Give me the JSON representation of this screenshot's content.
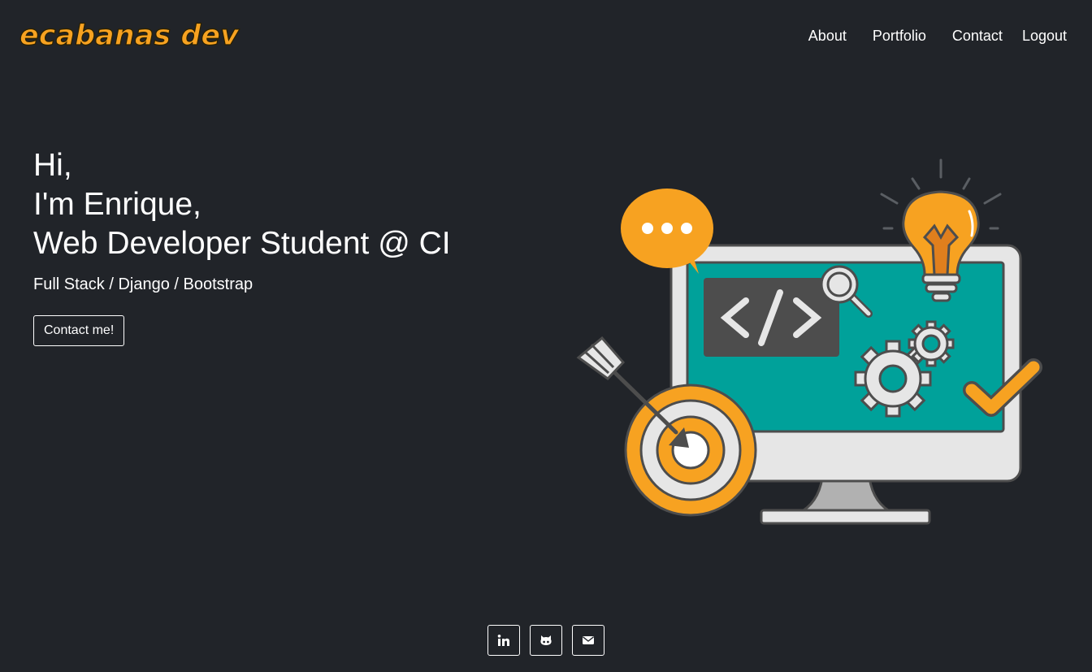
{
  "nav": {
    "brand": "ecabanas dev",
    "links": [
      "About",
      "Portfolio",
      "Contact",
      "Logout"
    ]
  },
  "hero": {
    "greeting": "Hi,",
    "name_line": "I'm Enrique,",
    "role_line": "Web Developer Student @ CI",
    "subtitle": "Full Stack / Django / Bootstrap",
    "cta_label": "Contact me!"
  },
  "social": {
    "icons": [
      "linkedin-icon",
      "github-icon",
      "email-icon"
    ]
  },
  "colors": {
    "background": "#212429",
    "brand_orange": "#F7A221",
    "teal": "#00A19A",
    "text": "#FFFFFF"
  }
}
